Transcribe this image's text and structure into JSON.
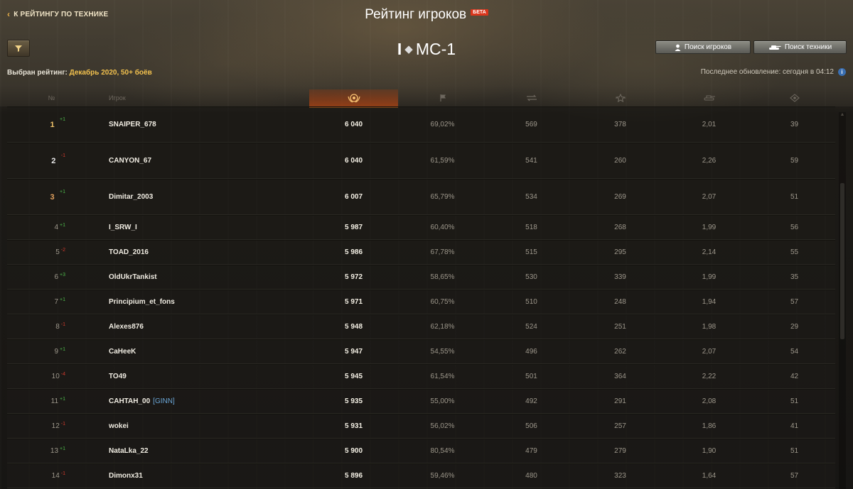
{
  "header": {
    "back_label": "К РЕЙТИНГУ ПО ТЕХНИКЕ",
    "title": "Рейтинг игроков",
    "beta_badge": "БЕТА",
    "vehicle_tier": "I",
    "vehicle_name": "МС-1",
    "search_players_label": "Поиск игроков",
    "search_vehicles_label": "Поиск техники",
    "selected_rating_label": "Выбран рейтинг:",
    "selected_rating_value": "Декабрь 2020, 50+ боёв",
    "last_update": "Последнее обновление: сегодня в 04:12"
  },
  "table": {
    "columns": {
      "rank": "№",
      "player": "Игрок"
    },
    "column_icons": [
      "rating-icon",
      "victories-icon",
      "damage-icon",
      "experience-icon",
      "kills-icon",
      "spotting-icon"
    ],
    "rows": [
      {
        "rank": "1",
        "medal": "gold",
        "change": "+1",
        "dir": "up",
        "name": "SNAIPER_678",
        "clan": "",
        "rating": "6 040",
        "win": "69,02%",
        "damage": "569",
        "xp": "378",
        "kills": "2,01",
        "spot": "39"
      },
      {
        "rank": "2",
        "medal": "silver",
        "change": "-1",
        "dir": "down",
        "name": "CANYON_67",
        "clan": "",
        "rating": "6 040",
        "win": "61,59%",
        "damage": "541",
        "xp": "260",
        "kills": "2,26",
        "spot": "59"
      },
      {
        "rank": "3",
        "medal": "bronze",
        "change": "+1",
        "dir": "up",
        "name": "Dimitar_2003",
        "clan": "",
        "rating": "6 007",
        "win": "65,79%",
        "damage": "534",
        "xp": "269",
        "kills": "2,07",
        "spot": "51"
      },
      {
        "rank": "4",
        "medal": "",
        "change": "+1",
        "dir": "up",
        "name": "I_SRW_I",
        "clan": "",
        "rating": "5 987",
        "win": "60,40%",
        "damage": "518",
        "xp": "268",
        "kills": "1,99",
        "spot": "56"
      },
      {
        "rank": "5",
        "medal": "",
        "change": "-2",
        "dir": "down",
        "name": "TOAD_2016",
        "clan": "",
        "rating": "5 986",
        "win": "67,78%",
        "damage": "515",
        "xp": "295",
        "kills": "2,14",
        "spot": "55"
      },
      {
        "rank": "6",
        "medal": "",
        "change": "+3",
        "dir": "up",
        "name": "OldUkrTankist",
        "clan": "",
        "rating": "5 972",
        "win": "58,65%",
        "damage": "530",
        "xp": "339",
        "kills": "1,99",
        "spot": "35"
      },
      {
        "rank": "7",
        "medal": "",
        "change": "+1",
        "dir": "up",
        "name": "Principium_et_fons",
        "clan": "",
        "rating": "5 971",
        "win": "60,75%",
        "damage": "510",
        "xp": "248",
        "kills": "1,94",
        "spot": "57"
      },
      {
        "rank": "8",
        "medal": "",
        "change": "-1",
        "dir": "down",
        "name": "Alexes876",
        "clan": "",
        "rating": "5 948",
        "win": "62,18%",
        "damage": "524",
        "xp": "251",
        "kills": "1,98",
        "spot": "29"
      },
      {
        "rank": "9",
        "medal": "",
        "change": "+1",
        "dir": "up",
        "name": "CaHeeK",
        "clan": "",
        "rating": "5 947",
        "win": "54,55%",
        "damage": "496",
        "xp": "262",
        "kills": "2,07",
        "spot": "54"
      },
      {
        "rank": "10",
        "medal": "",
        "change": "-4",
        "dir": "down",
        "name": "TO49",
        "clan": "",
        "rating": "5 945",
        "win": "61,54%",
        "damage": "501",
        "xp": "364",
        "kills": "2,22",
        "spot": "42"
      },
      {
        "rank": "11",
        "medal": "",
        "change": "+1",
        "dir": "up",
        "name": "CAHTAH_00",
        "clan": "[GINN]",
        "rating": "5 935",
        "win": "55,00%",
        "damage": "492",
        "xp": "291",
        "kills": "2,08",
        "spot": "51"
      },
      {
        "rank": "12",
        "medal": "",
        "change": "-1",
        "dir": "down",
        "name": "wokei",
        "clan": "",
        "rating": "5 931",
        "win": "56,02%",
        "damage": "506",
        "xp": "257",
        "kills": "1,86",
        "spot": "41"
      },
      {
        "rank": "13",
        "medal": "",
        "change": "+1",
        "dir": "up",
        "name": "NataLka_22",
        "clan": "",
        "rating": "5 900",
        "win": "80,54%",
        "damage": "479",
        "xp": "279",
        "kills": "1,90",
        "spot": "51"
      },
      {
        "rank": "14",
        "medal": "",
        "change": "-1",
        "dir": "down",
        "name": "Dimonx31",
        "clan": "",
        "rating": "5 896",
        "win": "59,46%",
        "damage": "480",
        "xp": "323",
        "kills": "1,64",
        "spot": "57"
      }
    ]
  },
  "colors": {
    "accent_orange": "#f07a1e",
    "rating_value_yellow": "#f2c14e",
    "change_up": "#4cb84a",
    "change_down": "#d13a2d",
    "beta_red": "#d9361c",
    "clan_blue": "#6aa5d6"
  }
}
